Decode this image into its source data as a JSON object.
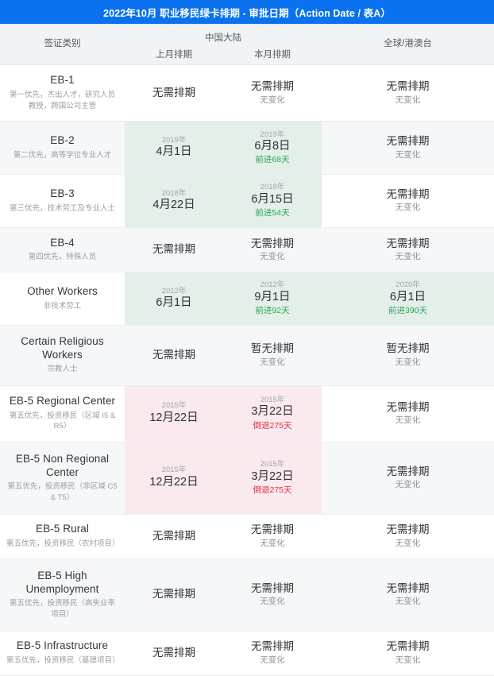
{
  "header": {
    "title": "2022年10月 职业移民绿卡排期 - 审批日期（Action Date / 表A）",
    "accent_color": "#0a72ee"
  },
  "columns": {
    "category": "签证类别",
    "china_group": "中国大陆",
    "china_prev": "上月排期",
    "china_curr": "本月排期",
    "global": "全球/港澳台"
  },
  "colors": {
    "forward": "#2aa65c",
    "backward": "#e0304a",
    "highlight_green": "#e3efe8",
    "highlight_pink": "#fae9ed",
    "stripe": "#f6f7f8"
  },
  "rows": [
    {
      "name": "EB-1",
      "desc": "第一优先，杰出人才，研究人员\n教授，跨国公司主管",
      "prev": {
        "year": "",
        "day": "",
        "main": "无需排期",
        "delta": "",
        "delta_type": "none",
        "highlight": "none"
      },
      "curr": {
        "year": "",
        "day": "",
        "main": "无需排期",
        "delta": "无变化",
        "delta_type": "nochange",
        "highlight": "none"
      },
      "global": {
        "year": "",
        "day": "",
        "main": "无需排期",
        "delta": "无变化",
        "delta_type": "nochange",
        "highlight": "none"
      }
    },
    {
      "name": "EB-2",
      "desc": "第二优先，高等学位专业人才",
      "prev": {
        "year": "2019年",
        "day": "4月1日",
        "main": "",
        "delta": "",
        "delta_type": "none",
        "highlight": "green"
      },
      "curr": {
        "year": "2019年",
        "day": "6月8日",
        "main": "",
        "delta": "前进68天",
        "delta_type": "forward",
        "highlight": "green"
      },
      "global": {
        "year": "",
        "day": "",
        "main": "无需排期",
        "delta": "无变化",
        "delta_type": "nochange",
        "highlight": "none"
      }
    },
    {
      "name": "EB-3",
      "desc": "第三优先，技术劳工及专业人士",
      "prev": {
        "year": "2018年",
        "day": "4月22日",
        "main": "",
        "delta": "",
        "delta_type": "none",
        "highlight": "green"
      },
      "curr": {
        "year": "2018年",
        "day": "6月15日",
        "main": "",
        "delta": "前进54天",
        "delta_type": "forward",
        "highlight": "green"
      },
      "global": {
        "year": "",
        "day": "",
        "main": "无需排期",
        "delta": "无变化",
        "delta_type": "nochange",
        "highlight": "none"
      }
    },
    {
      "name": "EB-4",
      "desc": "第四优先，特殊人员",
      "prev": {
        "year": "",
        "day": "",
        "main": "无需排期",
        "delta": "",
        "delta_type": "none",
        "highlight": "none"
      },
      "curr": {
        "year": "",
        "day": "",
        "main": "无需排期",
        "delta": "无变化",
        "delta_type": "nochange",
        "highlight": "none"
      },
      "global": {
        "year": "",
        "day": "",
        "main": "无需排期",
        "delta": "无变化",
        "delta_type": "nochange",
        "highlight": "none"
      }
    },
    {
      "name": "Other Workers",
      "desc": "非技术劳工",
      "prev": {
        "year": "2012年",
        "day": "6月1日",
        "main": "",
        "delta": "",
        "delta_type": "none",
        "highlight": "green"
      },
      "curr": {
        "year": "2012年",
        "day": "9月1日",
        "main": "",
        "delta": "前进92天",
        "delta_type": "forward",
        "highlight": "green"
      },
      "global": {
        "year": "2020年",
        "day": "6月1日",
        "main": "",
        "delta": "前进390天",
        "delta_type": "forward",
        "highlight": "green"
      }
    },
    {
      "name": "Certain Religious Workers",
      "desc": "宗教人士",
      "prev": {
        "year": "",
        "day": "",
        "main": "无需排期",
        "delta": "",
        "delta_type": "none",
        "highlight": "none"
      },
      "curr": {
        "year": "",
        "day": "",
        "main": "暂无排期",
        "delta": "无变化",
        "delta_type": "nochange",
        "highlight": "none"
      },
      "global": {
        "year": "",
        "day": "",
        "main": "暂无排期",
        "delta": "无变化",
        "delta_type": "nochange",
        "highlight": "none"
      }
    },
    {
      "name": "EB-5 Regional Center",
      "desc": "第五优先，投资移民（区域 I5 & R5）",
      "prev": {
        "year": "2015年",
        "day": "12月22日",
        "main": "",
        "delta": "",
        "delta_type": "none",
        "highlight": "pink"
      },
      "curr": {
        "year": "2015年",
        "day": "3月22日",
        "main": "",
        "delta": "倒退275天",
        "delta_type": "backward",
        "highlight": "pink"
      },
      "global": {
        "year": "",
        "day": "",
        "main": "无需排期",
        "delta": "无变化",
        "delta_type": "nochange",
        "highlight": "none"
      }
    },
    {
      "name": "EB-5 Non Regional Center",
      "desc": "第五优先，投资移民（非区域 C5 & T5）",
      "prev": {
        "year": "2015年",
        "day": "12月22日",
        "main": "",
        "delta": "",
        "delta_type": "none",
        "highlight": "pink"
      },
      "curr": {
        "year": "2015年",
        "day": "3月22日",
        "main": "",
        "delta": "倒退275天",
        "delta_type": "backward",
        "highlight": "pink"
      },
      "global": {
        "year": "",
        "day": "",
        "main": "无需排期",
        "delta": "无变化",
        "delta_type": "nochange",
        "highlight": "none"
      }
    },
    {
      "name": "EB-5 Rural",
      "desc": "第五优先，投资移民（农村项目）",
      "prev": {
        "year": "",
        "day": "",
        "main": "无需排期",
        "delta": "",
        "delta_type": "none",
        "highlight": "none"
      },
      "curr": {
        "year": "",
        "day": "",
        "main": "无需排期",
        "delta": "无变化",
        "delta_type": "nochange",
        "highlight": "none"
      },
      "global": {
        "year": "",
        "day": "",
        "main": "无需排期",
        "delta": "无变化",
        "delta_type": "nochange",
        "highlight": "none"
      }
    },
    {
      "name": "EB-5 High Unemployment",
      "desc": "第五优先，投资移民（高失业率项目）",
      "prev": {
        "year": "",
        "day": "",
        "main": "无需排期",
        "delta": "",
        "delta_type": "none",
        "highlight": "none"
      },
      "curr": {
        "year": "",
        "day": "",
        "main": "无需排期",
        "delta": "无变化",
        "delta_type": "nochange",
        "highlight": "none"
      },
      "global": {
        "year": "",
        "day": "",
        "main": "无需排期",
        "delta": "无变化",
        "delta_type": "nochange",
        "highlight": "none"
      }
    },
    {
      "name": "EB-5 Infrastructure",
      "desc": "第五优先，投资移民（基建项目）",
      "prev": {
        "year": "",
        "day": "",
        "main": "无需排期",
        "delta": "",
        "delta_type": "none",
        "highlight": "none"
      },
      "curr": {
        "year": "",
        "day": "",
        "main": "无需排期",
        "delta": "无变化",
        "delta_type": "nochange",
        "highlight": "none"
      },
      "global": {
        "year": "",
        "day": "",
        "main": "无需排期",
        "delta": "无变化",
        "delta_type": "nochange",
        "highlight": "none"
      }
    }
  ]
}
